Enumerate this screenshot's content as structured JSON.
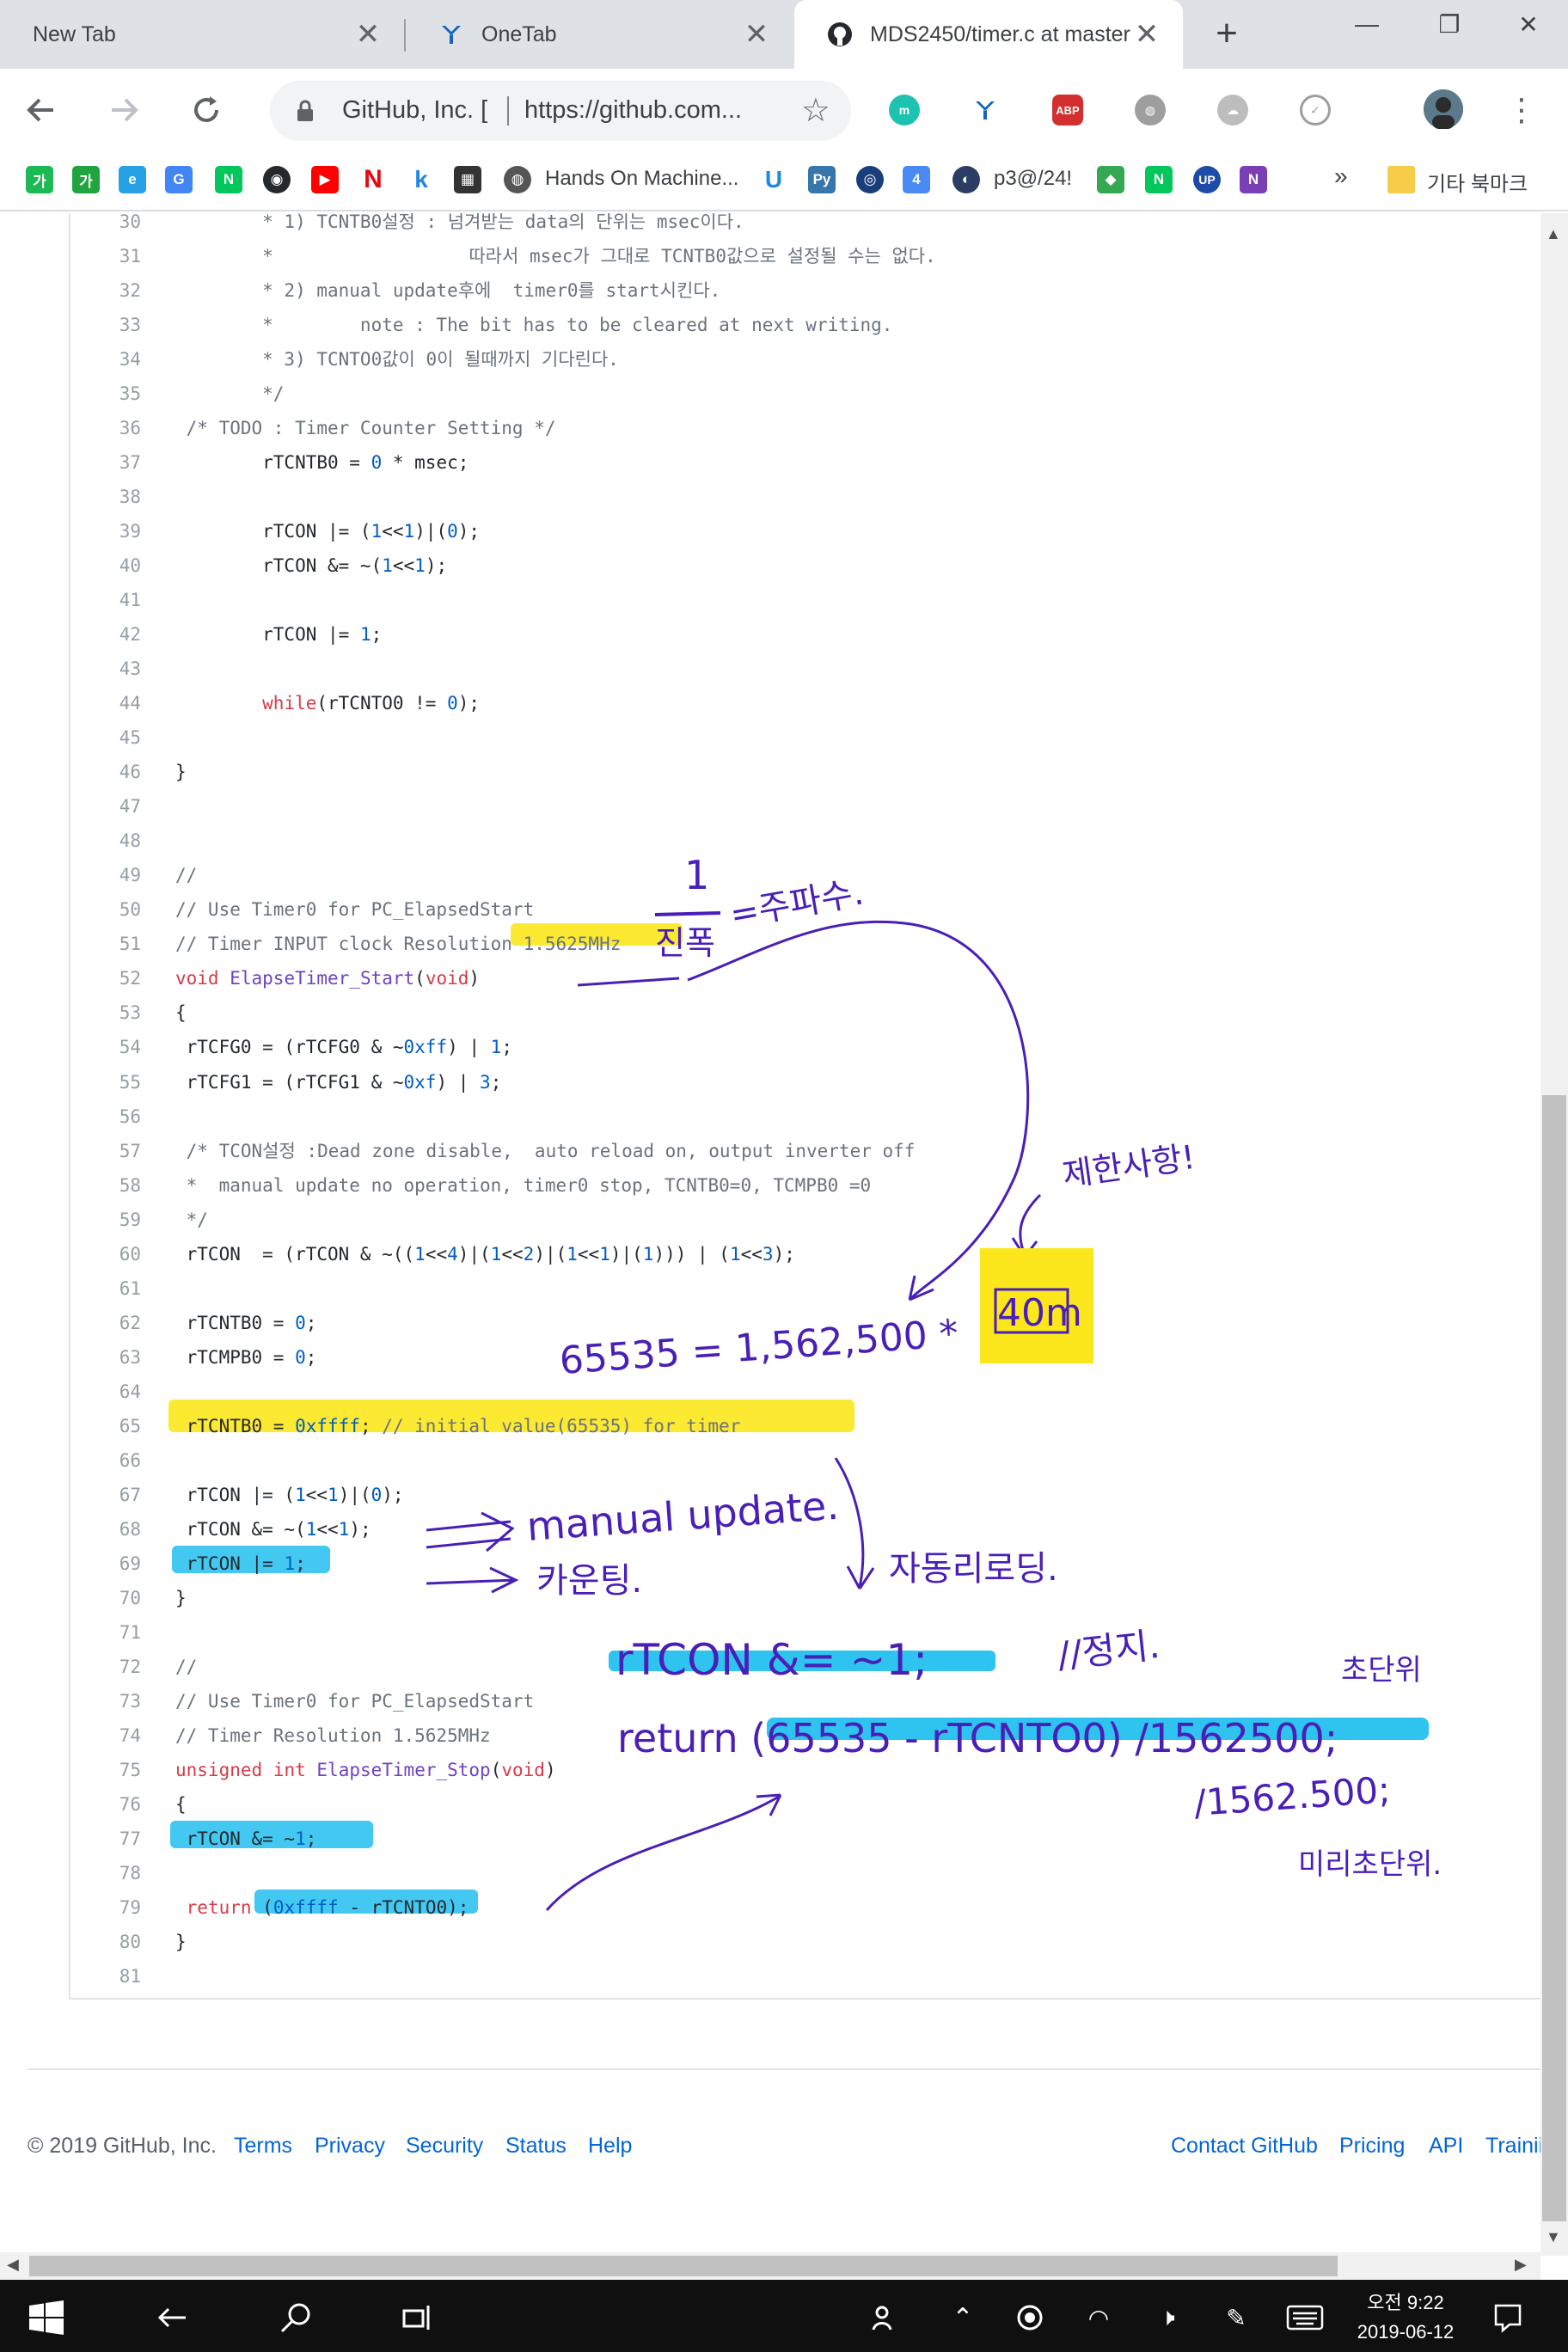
{
  "browser": {
    "tabs": [
      {
        "title": "New Tab",
        "active": false
      },
      {
        "title": "OneTab",
        "active": false
      },
      {
        "title": "MDS2450/timer.c at master",
        "active": true
      }
    ],
    "address": {
      "site": "GitHub, Inc. [",
      "url": "https://github.com..."
    },
    "bookmarks": {
      "item1": "Hands On Machine...",
      "item2": "p3@/24!",
      "more": "»",
      "other": "기타 북마크"
    }
  },
  "code": {
    "lines": [
      {
        "n": "30",
        "text": "        * 1) TCNTB0설정 : 넘겨받는 data의 단위는 msec이다."
      },
      {
        "n": "31",
        "text": "        *                  따라서 msec가 그대로 TCNTB0값으로 설정될 수는 없다."
      },
      {
        "n": "32",
        "text": "        * 2) manual update후에  timer0를 start시킨다."
      },
      {
        "n": "33",
        "text": "        *        note : The bit has to be cleared at next writing."
      },
      {
        "n": "34",
        "text": "        * 3) TCNTO0값이 0이 될때까지 기다린다."
      },
      {
        "n": "35",
        "text": "        */"
      },
      {
        "n": "36",
        "text": " /* TODO : Timer Counter Setting */"
      },
      {
        "n": "37",
        "text": "        rTCNTB0 = 0 * msec;"
      },
      {
        "n": "38",
        "text": ""
      },
      {
        "n": "39",
        "text": "        rTCON |= (1<<1)|(0);"
      },
      {
        "n": "40",
        "text": "        rTCON &= ~(1<<1);"
      },
      {
        "n": "41",
        "text": ""
      },
      {
        "n": "42",
        "text": "        rTCON |= 1;"
      },
      {
        "n": "43",
        "text": ""
      },
      {
        "n": "44",
        "text": "        while(rTCNTO0 != 0);"
      },
      {
        "n": "45",
        "text": ""
      },
      {
        "n": "46",
        "text": "}"
      },
      {
        "n": "47",
        "text": ""
      },
      {
        "n": "48",
        "text": ""
      },
      {
        "n": "49",
        "text": "//"
      },
      {
        "n": "50",
        "text": "// Use Timer0 for PC_ElapsedStart"
      },
      {
        "n": "51",
        "text": "// Timer INPUT clock Resolution 1.5625MHz"
      },
      {
        "n": "52",
        "text": "void ElapseTimer_Start(void)"
      },
      {
        "n": "53",
        "text": "{"
      },
      {
        "n": "54",
        "text": " rTCFG0 = (rTCFG0 & ~0xff) | 1;"
      },
      {
        "n": "55",
        "text": " rTCFG1 = (rTCFG1 & ~0xf) | 3;"
      },
      {
        "n": "56",
        "text": ""
      },
      {
        "n": "57",
        "text": " /* TCON설정 :Dead zone disable,  auto reload on, output inverter off"
      },
      {
        "n": "58",
        "text": " *  manual update no operation, timer0 stop, TCNTB0=0, TCMPB0 =0"
      },
      {
        "n": "59",
        "text": " */"
      },
      {
        "n": "60",
        "text": " rTCON  = (rTCON & ~((1<<4)|(1<<2)|(1<<1)|(1))) | (1<<3);"
      },
      {
        "n": "61",
        "text": ""
      },
      {
        "n": "62",
        "text": " rTCNTB0 = 0;"
      },
      {
        "n": "63",
        "text": " rTCMPB0 = 0;"
      },
      {
        "n": "64",
        "text": ""
      },
      {
        "n": "65",
        "text": " rTCNTB0 = 0xffff; // initial value(65535) for timer"
      },
      {
        "n": "66",
        "text": ""
      },
      {
        "n": "67",
        "text": " rTCON |= (1<<1)|(0);"
      },
      {
        "n": "68",
        "text": " rTCON &= ~(1<<1);"
      },
      {
        "n": "69",
        "text": " rTCON |= 1;"
      },
      {
        "n": "70",
        "text": "}"
      },
      {
        "n": "71",
        "text": ""
      },
      {
        "n": "72",
        "text": "//"
      },
      {
        "n": "73",
        "text": "// Use Timer0 for PC_ElapsedStart"
      },
      {
        "n": "74",
        "text": "// Timer Resolution 1.5625MHz"
      },
      {
        "n": "75",
        "text": "unsigned int ElapseTimer_Stop(void)"
      },
      {
        "n": "76",
        "text": "{"
      },
      {
        "n": "77",
        "text": " rTCON &= ~1;"
      },
      {
        "n": "78",
        "text": ""
      },
      {
        "n": "79",
        "text": " return (0xffff - rTCNTO0);"
      },
      {
        "n": "80",
        "text": "}"
      },
      {
        "n": "81",
        "text": ""
      }
    ]
  },
  "annotations": {
    "fraction_num": "1",
    "fraction_den": "진폭",
    "freq": "=주파수.",
    "limit": "제한사항!",
    "equation": "65535 = 1,562,500 *",
    "boxed": "40m",
    "manual": "manual update.",
    "counting": "카운팅.",
    "reload": "자동리로딩.",
    "stop_code": "rTCON &= ~1;",
    "stop_note": "//정지.",
    "return_code": "return (65535 - rTCNTO0) /1562500;",
    "second": "초단위",
    "alt_div": "/1562.500;",
    "milli": "미리초단위."
  },
  "footer": {
    "copyright": "© 2019 GitHub, Inc.",
    "links_left": [
      "Terms",
      "Privacy",
      "Security",
      "Status",
      "Help"
    ],
    "links_right": [
      "Contact GitHub",
      "Pricing",
      "API",
      "Trainii"
    ]
  },
  "taskbar": {
    "time": "오전 9:22",
    "date": "2019-06-12"
  },
  "colors": {
    "highlight_yellow": "#fbe71c",
    "highlight_blue": "#2fc3ef",
    "ink": "#4a1fb8",
    "link": "#0366d6"
  }
}
